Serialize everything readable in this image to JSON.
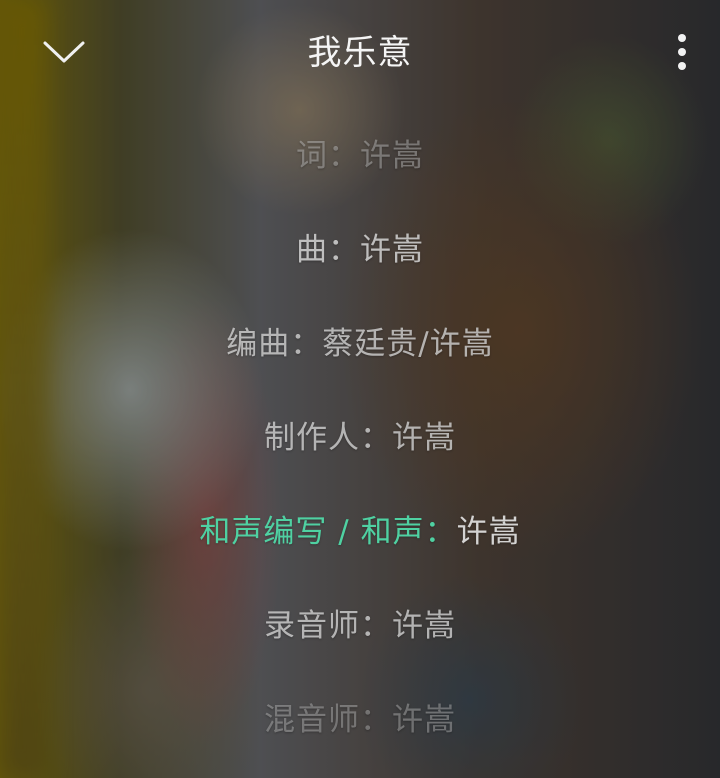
{
  "header": {
    "title": "我乐意",
    "back_icon": "chevron-down-icon",
    "more_icon": "more-vertical-icon"
  },
  "lyrics": {
    "lines": [
      "词：许嵩",
      "曲：许嵩",
      "编曲：蔡廷贵/许嵩",
      "制作人：许嵩"
    ],
    "current_line_sung": "和声编写 / 和声：",
    "current_line_rest": "许嵩",
    "lines_after": [
      "录音师：许嵩",
      "混音师：许嵩"
    ]
  },
  "colors": {
    "highlight": "#4fd1a2",
    "title": "#f5f5f5",
    "lyric_text": "#d7d7d7"
  }
}
